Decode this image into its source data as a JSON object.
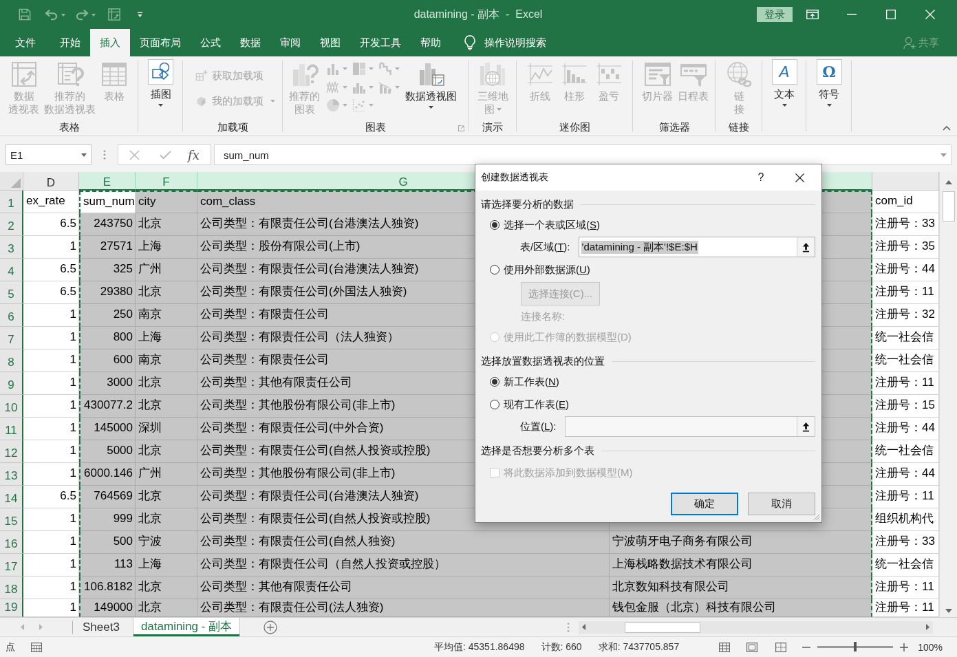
{
  "window": {
    "title": "datamining - 副本  -  Excel",
    "sign_in": "登录"
  },
  "tabs": [
    {
      "label": "文件",
      "selected": false
    },
    {
      "label": "开始",
      "selected": false
    },
    {
      "label": "插入",
      "selected": true
    },
    {
      "label": "页面布局",
      "selected": false
    },
    {
      "label": "公式",
      "selected": false
    },
    {
      "label": "数据",
      "selected": false
    },
    {
      "label": "审阅",
      "selected": false
    },
    {
      "label": "视图",
      "selected": false
    },
    {
      "label": "开发工具",
      "selected": false
    },
    {
      "label": "帮助",
      "selected": false
    }
  ],
  "tell_me": "操作说明搜索",
  "share": "共享",
  "ribbon": {
    "groups": [
      {
        "label": "表格",
        "items": [
          {
            "kind": "large",
            "lines": [
              "数据",
              "透视表"
            ],
            "disabled": true
          },
          {
            "kind": "large",
            "lines": [
              "推荐的",
              "数据透视表"
            ],
            "disabled": true
          },
          {
            "kind": "large",
            "lines": [
              "表格"
            ],
            "disabled": true
          }
        ]
      },
      {
        "items": [
          {
            "kind": "boxed",
            "lines": [
              "插图"
            ],
            "disabled": false,
            "dropdown": true
          }
        ]
      },
      {
        "label": "加载项",
        "items": [
          {
            "kind": "small",
            "lines": [
              "获取加载项"
            ],
            "disabled": true
          },
          {
            "kind": "small",
            "lines": [
              "我的加载项"
            ],
            "disabled": true,
            "dropdown": true
          }
        ]
      },
      {
        "label": "图表",
        "launcher": true,
        "items": [
          {
            "kind": "large",
            "lines": [
              "推荐的",
              "图表"
            ],
            "disabled": true
          },
          {
            "kind": "gallery",
            "buttons": [
              {
                "disabled": true,
                "dropdown": true
              },
              {
                "disabled": true,
                "dropdown": true
              },
              {
                "disabled": true,
                "dropdown": true
              },
              {
                "disabled": true,
                "dropdown": true
              },
              {
                "disabled": true,
                "dropdown": true
              },
              {
                "disabled": true,
                "dropdown": true
              },
              {
                "disabled": true,
                "dropdown": true
              },
              {
                "disabled": true,
                "dropdown": true
              }
            ]
          },
          {
            "kind": "large",
            "lines": [
              "数据透视图"
            ],
            "disabled": false,
            "dropdown": true
          }
        ]
      },
      {
        "label": "演示",
        "items": [
          {
            "kind": "large",
            "lines": [
              "三维地",
              "图"
            ],
            "disabled": true,
            "dropdown": true
          }
        ]
      },
      {
        "label": "迷你图",
        "items": [
          {
            "kind": "large",
            "lines": [
              "折线"
            ],
            "disabled": true
          },
          {
            "kind": "large",
            "lines": [
              "柱形"
            ],
            "disabled": true
          },
          {
            "kind": "large",
            "lines": [
              "盈亏"
            ],
            "disabled": true
          }
        ]
      },
      {
        "label": "筛选器",
        "items": [
          {
            "kind": "large",
            "lines": [
              "切片器"
            ],
            "disabled": true
          },
          {
            "kind": "large",
            "lines": [
              "日程表"
            ],
            "disabled": true
          }
        ]
      },
      {
        "label": "链接",
        "items": [
          {
            "kind": "large",
            "lines": [
              "链",
              "接"
            ],
            "disabled": true
          }
        ]
      },
      {
        "items": [
          {
            "kind": "boxed",
            "glyph": "A",
            "lines": [
              "文本"
            ],
            "disabled": false,
            "dropdown": true
          }
        ]
      },
      {
        "items": [
          {
            "kind": "boxed",
            "glyph": "Ω",
            "lines": [
              "符号"
            ],
            "disabled": false,
            "dropdown": true
          }
        ]
      }
    ]
  },
  "formula_bar": {
    "name_box": "E1",
    "function_label": "fx",
    "formula": "sum_num"
  },
  "sheet": {
    "copy_marquee": true,
    "columns": [
      {
        "letter": "D",
        "selected": false
      },
      {
        "letter": "E",
        "selected": true
      },
      {
        "letter": "F",
        "selected": true
      },
      {
        "letter": "G",
        "selected": true
      },
      {
        "selected": true
      },
      {
        "selected": false
      }
    ],
    "rows": [
      {
        "number": "1",
        "selected": true,
        "cells": [
          "ex_rate",
          "sum_num",
          "city",
          "com_class",
          null,
          "com_id"
        ]
      },
      {
        "number": "2",
        "selected": true,
        "cells": [
          "6.5",
          "243750",
          "北京",
          "公司类型：有限责任公司(台港澳法人独资)",
          null,
          "注册号：33"
        ]
      },
      {
        "number": "3",
        "selected": true,
        "cells": [
          "1",
          "27571",
          "上海",
          "公司类型：股份有限公司(上市)",
          null,
          "注册号：35"
        ]
      },
      {
        "number": "4",
        "selected": true,
        "cells": [
          "6.5",
          "325",
          "广州",
          "公司类型：有限责任公司(台港澳法人独资)",
          null,
          "注册号：44"
        ]
      },
      {
        "number": "5",
        "selected": true,
        "cells": [
          "6.5",
          "29380",
          "北京",
          "公司类型：有限责任公司(外国法人独资)",
          null,
          "注册号：11"
        ]
      },
      {
        "number": "6",
        "selected": true,
        "cells": [
          "1",
          "250",
          "南京",
          "公司类型：有限责任公司",
          null,
          "注册号：32"
        ]
      },
      {
        "number": "7",
        "selected": true,
        "cells": [
          "1",
          "800",
          "上海",
          "公司类型：有限责任公司（法人独资）",
          null,
          "统一社会信"
        ]
      },
      {
        "number": "8",
        "selected": true,
        "cells": [
          "1",
          "600",
          "南京",
          "公司类型：有限责任公司",
          null,
          "统一社会信"
        ]
      },
      {
        "number": "9",
        "selected": true,
        "cells": [
          "1",
          "3000",
          "北京",
          "公司类型：其他有限责任公司",
          null,
          "注册号：11"
        ]
      },
      {
        "number": "10",
        "selected": true,
        "cells": [
          "1",
          "430077.2",
          "北京",
          "公司类型：其他股份有限公司(非上市)",
          null,
          "注册号：15"
        ]
      },
      {
        "number": "11",
        "selected": true,
        "cells": [
          "1",
          "145000",
          "深圳",
          "公司类型：有限责任公司(中外合资)",
          null,
          "注册号：44"
        ]
      },
      {
        "number": "12",
        "selected": true,
        "cells": [
          "1",
          "5000",
          "北京",
          "公司类型：有限责任公司(自然人投资或控股)",
          null,
          "统一社会信"
        ]
      },
      {
        "number": "13",
        "selected": true,
        "cells": [
          "1",
          "6000.146",
          "广州",
          "公司类型：其他股份有限公司(非上市)",
          null,
          "注册号：44"
        ]
      },
      {
        "number": "14",
        "selected": true,
        "cells": [
          "6.5",
          "764569",
          "北京",
          "公司类型：有限责任公司(台港澳法人独资)",
          null,
          "注册号：11"
        ]
      },
      {
        "number": "15",
        "selected": true,
        "cells": [
          "1",
          "999",
          "北京",
          "公司类型：有限责任公司(自然人投资或控股)",
          null,
          "组织机构代"
        ]
      },
      {
        "number": "16",
        "selected": true,
        "cells": [
          "1",
          "500",
          "宁波",
          "公司类型：有限责任公司(自然人独资)",
          "宁波萌牙电子商务有限公司",
          "注册号：33"
        ]
      },
      {
        "number": "17",
        "selected": true,
        "cells": [
          "1",
          "113",
          "上海",
          "公司类型：有限责任公司（自然人投资或控股）",
          "上海栈略数据技术有限公司",
          "统一社会信"
        ]
      },
      {
        "number": "18",
        "selected": true,
        "cells": [
          "1",
          "106.8182",
          "北京",
          "公司类型：其他有限责任公司",
          "北京数知科技有限公司",
          "注册号：11"
        ]
      },
      {
        "number": "19",
        "selected": true,
        "cells": [
          "1",
          "149000",
          "北京",
          "公司类型：有限责任公司(法人独资)",
          "钱包金服（北京）科技有限公司",
          "注册号：11"
        ]
      }
    ]
  },
  "sheet_tabs": [
    {
      "label": "Sheet3",
      "selected": false
    },
    {
      "label": "datamining - 副本",
      "selected": true
    }
  ],
  "status": {
    "mode": "点",
    "stats": [
      "平均值: 45351.86498",
      "计数: 660",
      "求和: 7437705.857"
    ],
    "zoom": {
      "label": "100%",
      "level": 0.5
    }
  },
  "dialog": {
    "title": "创建数据透视表",
    "help": "?",
    "sections": [
      {
        "heading": "请选择要分析的数据",
        "items": [
          {
            "kind": "radio",
            "label": "选择一个表或区域(",
            "access_key": "S",
            "label_end": ")",
            "selected": true,
            "disabled": false
          },
          {
            "kind": "field",
            "label": "表/区域(",
            "access_key": "T",
            "label_end": "):",
            "value": "'datamining - 副本'!$E:$H",
            "value_selected": true,
            "disabled": false
          },
          {
            "kind": "radio",
            "label": "使用外部数据源(",
            "access_key": "U",
            "label_end": ")",
            "selected": false,
            "disabled": false
          },
          {
            "kind": "button",
            "label": "选择连接(C)...",
            "disabled": true
          },
          {
            "kind": "note",
            "label": "连接名称:",
            "disabled": true
          },
          {
            "kind": "radio",
            "label": "使用此工作簿的数据模型(D)",
            "selected": false,
            "disabled": true
          }
        ]
      },
      {
        "heading": "选择放置数据透视表的位置",
        "items": [
          {
            "kind": "radio",
            "label": "新工作表(",
            "access_key": "N",
            "label_end": ")",
            "selected": true,
            "disabled": false
          },
          {
            "kind": "radio",
            "label": "现有工作表(",
            "access_key": "E",
            "label_end": ")",
            "selected": false,
            "disabled": false
          },
          {
            "kind": "field",
            "label": "位置(",
            "access_key": "L",
            "label_end": "):",
            "disabled": true
          }
        ]
      },
      {
        "heading": "选择是否想要分析多个表",
        "items": [
          {
            "kind": "checkbox",
            "label": "将此数据添加到数据模型(M)",
            "checked": false,
            "disabled": true
          }
        ]
      }
    ],
    "buttons": [
      {
        "label": "确定",
        "default": true
      },
      {
        "label": "取消",
        "default": false
      }
    ]
  }
}
